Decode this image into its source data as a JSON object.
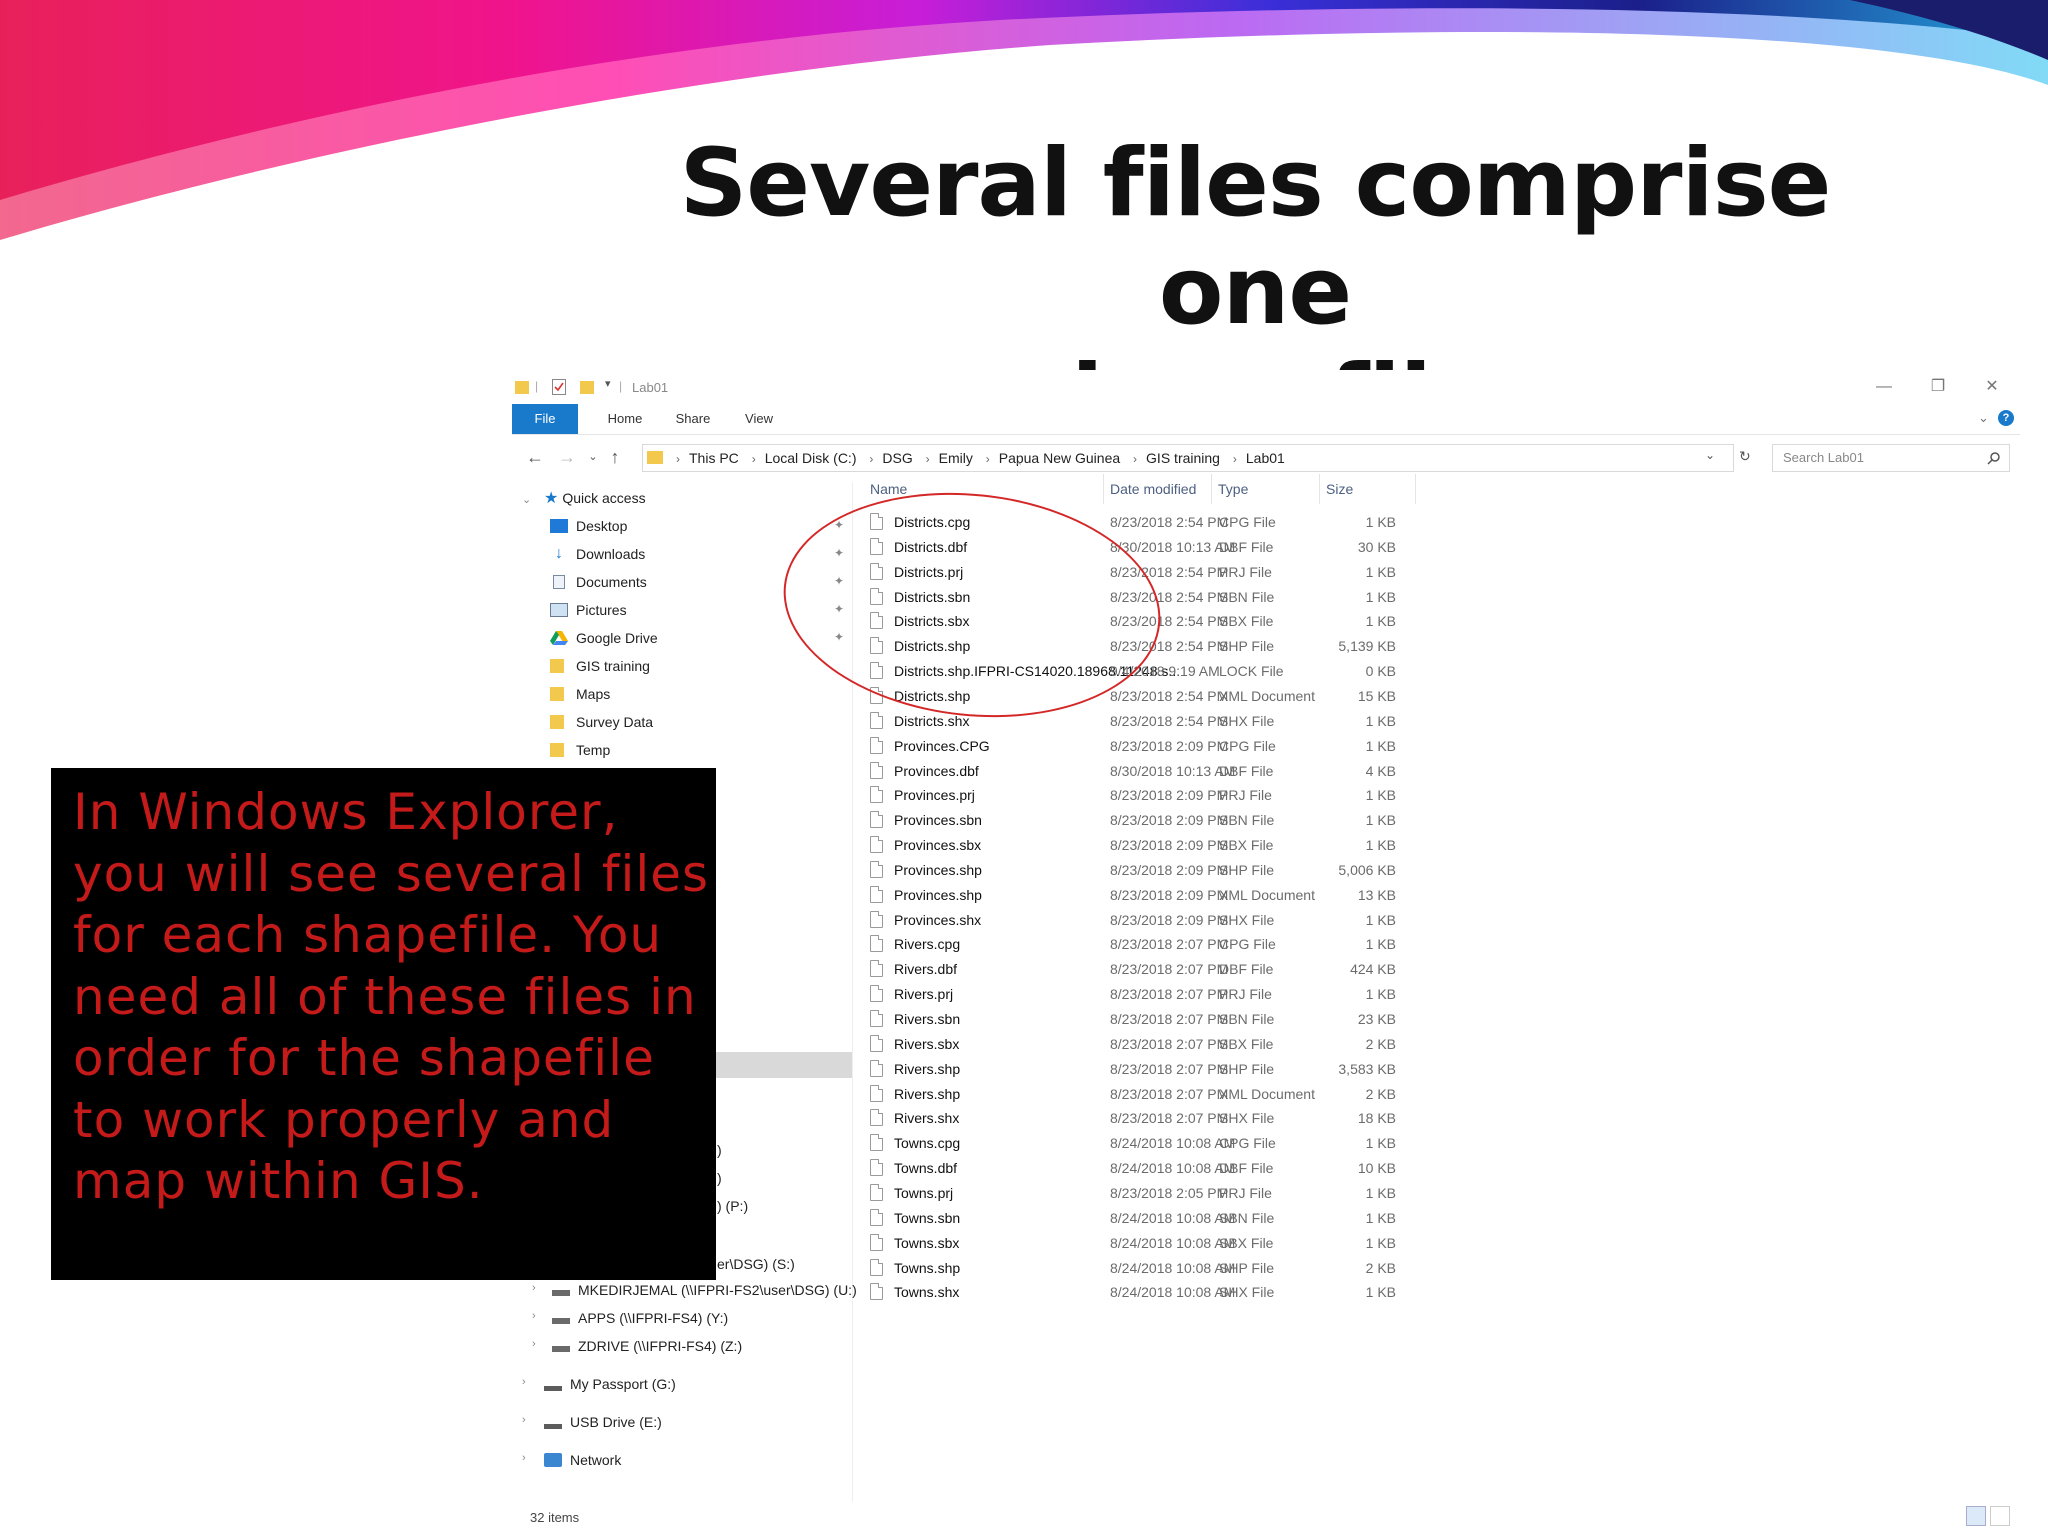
{
  "slide": {
    "title_line1": "Several files comprise one",
    "title_line2": "shapefile",
    "callout": "In Windows Explorer, you will see several files for each shapefile. You need all of these files in order for the shapefile to work properly and map within GIS."
  },
  "window": {
    "title": "Lab01",
    "controls": {
      "minimize": "—",
      "restore": "❐",
      "close": "✕"
    },
    "ribbon_tabs": [
      "File",
      "Home",
      "Share",
      "View"
    ],
    "breadcrumb": [
      "This PC",
      "Local Disk (C:)",
      "DSG",
      "Emily",
      "Papua New Guinea",
      "GIS training",
      "Lab01"
    ],
    "search_placeholder": "Search Lab01",
    "status": "32 items"
  },
  "nav": {
    "quick_access": "Quick access",
    "items": [
      {
        "label": "Desktop",
        "icon": "desktop-icon",
        "pinned": true
      },
      {
        "label": "Downloads",
        "icon": "download-icon",
        "pinned": true
      },
      {
        "label": "Documents",
        "icon": "document-icon",
        "pinned": true
      },
      {
        "label": "Pictures",
        "icon": "picture-icon",
        "pinned": true
      },
      {
        "label": "Google Drive",
        "icon": "google-drive-icon",
        "pinned": true
      },
      {
        "label": "GIS training",
        "icon": "folder-icon",
        "pinned": false
      },
      {
        "label": "Maps",
        "icon": "folder-icon",
        "pinned": false
      },
      {
        "label": "Survey Data",
        "icon": "folder-icon",
        "pinned": false
      },
      {
        "label": "Temp",
        "icon": "folder-icon",
        "pinned": false
      }
    ],
    "partial": [
      ")",
      ")",
      ") (P:)",
      "er\\DSG) (S:)"
    ],
    "drives": [
      {
        "label": "MKEDIRJEMAL (\\\\IFPRI-FS2\\user\\DSG) (U:)",
        "icon": "network-drive-icon"
      },
      {
        "label": "APPS (\\\\IFPRI-FS4) (Y:)",
        "icon": "network-drive-icon"
      },
      {
        "label": "ZDRIVE (\\\\IFPRI-FS4) (Z:)",
        "icon": "network-drive-icon"
      }
    ],
    "my_passport": "My Passport (G:)",
    "usb_drive": "USB Drive (E:)",
    "network": "Network"
  },
  "list": {
    "columns": [
      "Name",
      "Date modified",
      "Type",
      "Size"
    ],
    "files": [
      {
        "name": "Districts.cpg",
        "date": "8/23/2018 2:54 PM",
        "type": "CPG File",
        "size": "1 KB"
      },
      {
        "name": "Districts.dbf",
        "date": "8/30/2018 10:13 AM",
        "type": "DBF File",
        "size": "30 KB"
      },
      {
        "name": "Districts.prj",
        "date": "8/23/2018 2:54 PM",
        "type": "PRJ File",
        "size": "1 KB"
      },
      {
        "name": "Districts.sbn",
        "date": "8/23/2018 2:54 PM",
        "type": "SBN File",
        "size": "1 KB"
      },
      {
        "name": "Districts.sbx",
        "date": "8/23/2018 2:54 PM",
        "type": "SBX File",
        "size": "1 KB"
      },
      {
        "name": "Districts.shp",
        "date": "8/23/2018 2:54 PM",
        "type": "SHP File",
        "size": "5,139 KB"
      },
      {
        "name": "Districts.shp.IFPRI-CS14020.18968.11248.s...",
        "date": "9/4/2018 9:19 AM",
        "type": "LOCK File",
        "size": "0 KB"
      },
      {
        "name": "Districts.shp",
        "date": "8/23/2018 2:54 PM",
        "type": "XML Document",
        "size": "15 KB"
      },
      {
        "name": "Districts.shx",
        "date": "8/23/2018 2:54 PM",
        "type": "SHX File",
        "size": "1 KB"
      },
      {
        "name": "Provinces.CPG",
        "date": "8/23/2018 2:09 PM",
        "type": "CPG File",
        "size": "1 KB"
      },
      {
        "name": "Provinces.dbf",
        "date": "8/30/2018 10:13 AM",
        "type": "DBF File",
        "size": "4 KB"
      },
      {
        "name": "Provinces.prj",
        "date": "8/23/2018 2:09 PM",
        "type": "PRJ File",
        "size": "1 KB"
      },
      {
        "name": "Provinces.sbn",
        "date": "8/23/2018 2:09 PM",
        "type": "SBN File",
        "size": "1 KB"
      },
      {
        "name": "Provinces.sbx",
        "date": "8/23/2018 2:09 PM",
        "type": "SBX File",
        "size": "1 KB"
      },
      {
        "name": "Provinces.shp",
        "date": "8/23/2018 2:09 PM",
        "type": "SHP File",
        "size": "5,006 KB"
      },
      {
        "name": "Provinces.shp",
        "date": "8/23/2018 2:09 PM",
        "type": "XML Document",
        "size": "13 KB"
      },
      {
        "name": "Provinces.shx",
        "date": "8/23/2018 2:09 PM",
        "type": "SHX File",
        "size": "1 KB"
      },
      {
        "name": "Rivers.cpg",
        "date": "8/23/2018 2:07 PM",
        "type": "CPG File",
        "size": "1 KB"
      },
      {
        "name": "Rivers.dbf",
        "date": "8/23/2018 2:07 PM",
        "type": "DBF File",
        "size": "424 KB"
      },
      {
        "name": "Rivers.prj",
        "date": "8/23/2018 2:07 PM",
        "type": "PRJ File",
        "size": "1 KB"
      },
      {
        "name": "Rivers.sbn",
        "date": "8/23/2018 2:07 PM",
        "type": "SBN File",
        "size": "23 KB"
      },
      {
        "name": "Rivers.sbx",
        "date": "8/23/2018 2:07 PM",
        "type": "SBX File",
        "size": "2 KB"
      },
      {
        "name": "Rivers.shp",
        "date": "8/23/2018 2:07 PM",
        "type": "SHP File",
        "size": "3,583 KB"
      },
      {
        "name": "Rivers.shp",
        "date": "8/23/2018 2:07 PM",
        "type": "XML Document",
        "size": "2 KB"
      },
      {
        "name": "Rivers.shx",
        "date": "8/23/2018 2:07 PM",
        "type": "SHX File",
        "size": "18 KB"
      },
      {
        "name": "Towns.cpg",
        "date": "8/24/2018 10:08 AM",
        "type": "CPG File",
        "size": "1 KB"
      },
      {
        "name": "Towns.dbf",
        "date": "8/24/2018 10:08 AM",
        "type": "DBF File",
        "size": "10 KB"
      },
      {
        "name": "Towns.prj",
        "date": "8/23/2018 2:05 PM",
        "type": "PRJ File",
        "size": "1 KB"
      },
      {
        "name": "Towns.sbn",
        "date": "8/24/2018 10:08 AM",
        "type": "SBN File",
        "size": "1 KB"
      },
      {
        "name": "Towns.sbx",
        "date": "8/24/2018 10:08 AM",
        "type": "SBX File",
        "size": "1 KB"
      },
      {
        "name": "Towns.shp",
        "date": "8/24/2018 10:08 AM",
        "type": "SHP File",
        "size": "2 KB"
      },
      {
        "name": "Towns.shx",
        "date": "8/24/2018 10:08 AM",
        "type": "SHX File",
        "size": "1 KB"
      }
    ]
  },
  "colors": {
    "ribbon_file": "#1979ca",
    "callout_text": "#c41a1a",
    "circle": "#d42828",
    "header_text": "#4d6082"
  }
}
